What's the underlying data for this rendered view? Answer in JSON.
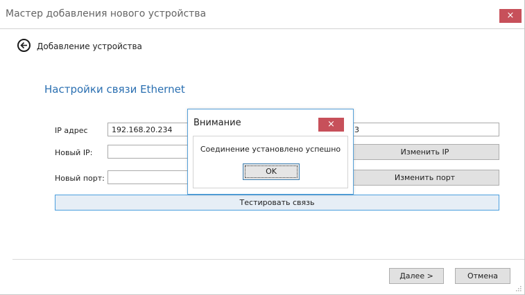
{
  "window": {
    "title": "Мастер добавления нового устройства",
    "close_icon": "×"
  },
  "header": {
    "back_icon": "arrow-left-circle-icon",
    "subtitle": "Добавление устройства"
  },
  "section": {
    "title": "Настройки связи Ethernet"
  },
  "form": {
    "ip_label": "IP адрес",
    "ip_value": "192.168.20.234",
    "port_value_partial": "3",
    "new_ip_label": "Новый IP:",
    "new_ip_value": "",
    "change_ip_button": "Изменить IP",
    "new_port_label": "Новый порт:",
    "new_port_value": "",
    "change_port_button": "Изменить порт",
    "test_button": "Тестировать связь"
  },
  "footer": {
    "next_button": "Далее >",
    "cancel_button": "Отмена"
  },
  "dialog": {
    "title": "Внимание",
    "close_icon": "×",
    "message": "Соединение установлено успешно",
    "ok_button": "OK"
  },
  "colors": {
    "accent": "#2a6fb1",
    "close_red": "#c7505a",
    "focus_border": "#4a9ede"
  }
}
